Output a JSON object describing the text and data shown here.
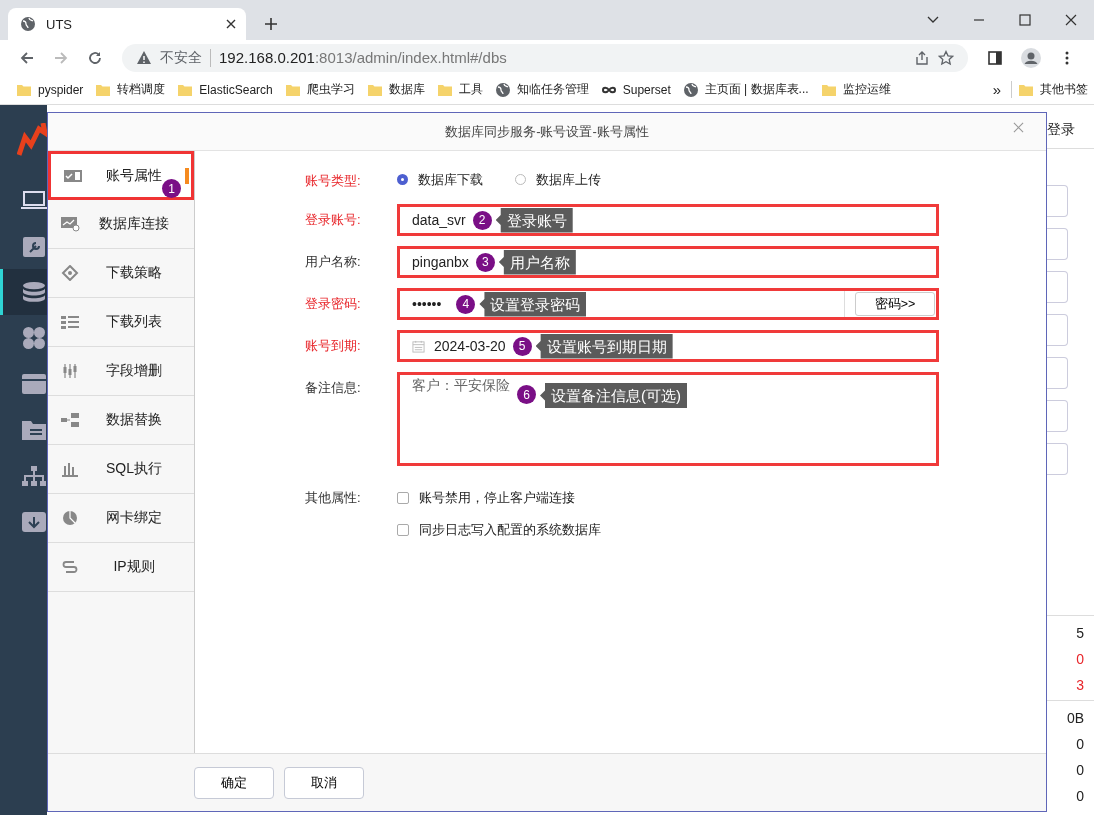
{
  "browser": {
    "tab_title": "UTS",
    "security_label": "不安全",
    "url_host": "192.168.0.201",
    "url_rest": ":8013/admin/index.html#/dbs",
    "bookmarks": [
      {
        "label": "pyspider",
        "kind": "folder"
      },
      {
        "label": "转档调度",
        "kind": "folder"
      },
      {
        "label": "ElasticSearch",
        "kind": "folder"
      },
      {
        "label": "爬虫学习",
        "kind": "folder"
      },
      {
        "label": "数据库",
        "kind": "folder"
      },
      {
        "label": "工具",
        "kind": "folder"
      },
      {
        "label": "知临任务管理",
        "kind": "globe"
      },
      {
        "label": "Superset",
        "kind": "infinity"
      },
      {
        "label": "主页面 | 数据库表...",
        "kind": "globe"
      },
      {
        "label": "监控运维",
        "kind": "folder"
      }
    ],
    "overflow": "»",
    "other_bookmarks": "其他书签"
  },
  "app_sidebar": {
    "items": [
      {
        "kind": "laptop",
        "selected": false
      },
      {
        "kind": "calendar",
        "selected": false
      },
      {
        "kind": "database",
        "selected": true
      },
      {
        "kind": "clover",
        "selected": false
      },
      {
        "kind": "archive",
        "selected": false
      },
      {
        "kind": "folder",
        "selected": false
      },
      {
        "kind": "tree",
        "selected": false
      },
      {
        "kind": "download",
        "selected": false
      }
    ]
  },
  "dialog": {
    "title": "数据库同步服务-账号设置-账号属性",
    "nav": [
      {
        "label": "账号属性",
        "kind": "card",
        "selected": true,
        "badge": "1"
      },
      {
        "label": "数据库连接",
        "kind": "monitor",
        "selected": false
      },
      {
        "label": "下载策略",
        "kind": "diamond",
        "selected": false
      },
      {
        "label": "下载列表",
        "kind": "list",
        "selected": false
      },
      {
        "label": "字段增删",
        "kind": "sliders",
        "selected": false
      },
      {
        "label": "数据替换",
        "kind": "flow",
        "selected": false
      },
      {
        "label": "SQL执行",
        "kind": "bars",
        "selected": false
      },
      {
        "label": "网卡绑定",
        "kind": "pie",
        "selected": false
      },
      {
        "label": "IP规则",
        "kind": "link",
        "selected": false
      }
    ],
    "account_type": {
      "label": "账号类型:",
      "required": true,
      "options": [
        {
          "label": "数据库下载",
          "selected": true
        },
        {
          "label": "数据库上传",
          "selected": false
        }
      ]
    },
    "fields": [
      {
        "kind": "text",
        "label": "登录账号:",
        "required": true,
        "value": "data_svr",
        "badge": "2",
        "hint": "登录账号"
      },
      {
        "kind": "text",
        "label": "用户名称:",
        "required": false,
        "value": "pinganbx",
        "badge": "3",
        "hint": "用户名称"
      },
      {
        "kind": "password",
        "label": "登录密码:",
        "required": true,
        "value": "••••••",
        "badge": "4",
        "hint": "设置登录密码",
        "button": "密码>>"
      },
      {
        "kind": "date",
        "label": "账号到期:",
        "required": true,
        "value": "2024-03-20",
        "badge": "5",
        "hint": "设置账号到期日期"
      },
      {
        "kind": "textarea",
        "label": "备注信息:",
        "required": false,
        "value": "客户：平安保险",
        "badge": "6",
        "hint": "设置备注信息(可选)"
      }
    ],
    "other": {
      "label": "其他属性:",
      "checkboxes": [
        {
          "label": "账号禁用，停止客户端连接",
          "checked": false
        },
        {
          "label": "同步日志写入配置的系统数据库",
          "checked": false
        }
      ]
    },
    "buttons": [
      "确定",
      "取消"
    ]
  },
  "background": {
    "header_text": "登录",
    "stat_groups": [
      [
        {
          "text": "5",
          "alert": false
        },
        {
          "text": "0",
          "alert": true
        },
        {
          "text": "3",
          "alert": true
        }
      ],
      [
        {
          "text": "0B",
          "alert": false
        },
        {
          "text": "0",
          "alert": false
        },
        {
          "text": "0",
          "alert": false
        },
        {
          "text": "0",
          "alert": false
        }
      ]
    ]
  }
}
